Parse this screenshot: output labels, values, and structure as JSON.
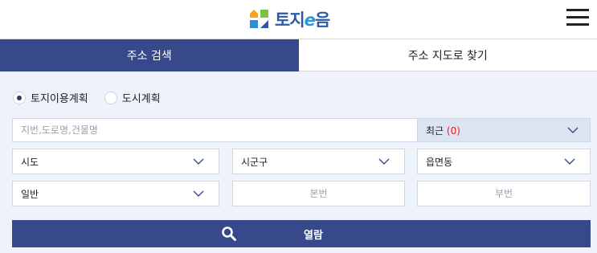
{
  "header": {
    "logo_text_main": "토지",
    "logo_text_e": "e",
    "logo_text_end": "음",
    "menu_icon": "hamburger-menu-icon"
  },
  "tabs": [
    {
      "label": "주소 검색",
      "active": true
    },
    {
      "label": "주소 지도로 찾기",
      "active": false
    }
  ],
  "radios": [
    {
      "label": "토지이용계획",
      "selected": true
    },
    {
      "label": "도시계획",
      "selected": false
    }
  ],
  "search": {
    "placeholder": "지번,도로명,건물명",
    "value": ""
  },
  "recent": {
    "label": "최근",
    "count": "(0)"
  },
  "selects": {
    "sido": "시도",
    "sigungu": "시군구",
    "eupmyeondong": "읍면동",
    "lot_type": "일반"
  },
  "lot_inputs": {
    "main_placeholder": "본번",
    "sub_placeholder": "부번"
  },
  "view_button": {
    "label": "열람",
    "icon": "search-icon"
  },
  "colors": {
    "primary": "#37498a",
    "panel_bg": "#eef3fb",
    "recent_bg": "#dde4f1",
    "count_red": "#e0201c",
    "logo_blue": "#2c5aa9"
  }
}
